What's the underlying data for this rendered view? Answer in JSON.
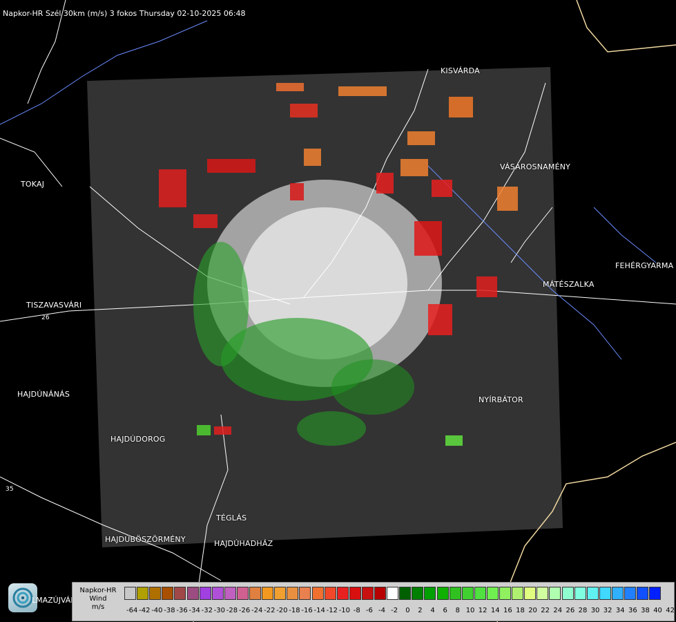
{
  "title": "Napkor-HR Szél 30km (m/s) 3 fokos Thursday 02-10-2025 06:48",
  "cities": [
    {
      "name": "KISVÁRDA"
    },
    {
      "name": "TOKAJ"
    },
    {
      "name": "VÁSÁROSNAMÉNY"
    },
    {
      "name": "FEHÉRGYARMA"
    },
    {
      "name": "MÁTÉSZALKA"
    },
    {
      "name": "TISZAVASVÁRI"
    },
    {
      "name": "HAJDÚNÁNÁS"
    },
    {
      "name": "NYÍRBÁTOR"
    },
    {
      "name": "HAJDÚDOROG"
    },
    {
      "name": "TÉGLÁS"
    },
    {
      "name": "HAJDÚBÖSZÖRMÉNY"
    },
    {
      "name": "HAJDÚHADHÁZ"
    }
  ],
  "roads": [
    "26",
    "35"
  ],
  "logo_text": "LMAZÚJVÁR",
  "legend": {
    "line1": "Napkor-HR",
    "line2": "Wind",
    "line3": "m/s",
    "ticks": [
      "-64",
      "-42",
      "-40",
      "-38",
      "-36",
      "-34",
      "-32",
      "-30",
      "-28",
      "-26",
      "-24",
      "-22",
      "-20",
      "-18",
      "-16",
      "-14",
      "-12",
      "-10",
      "-8",
      "-6",
      "-4",
      "-2",
      "0",
      "2",
      "4",
      "6",
      "8",
      "10",
      "12",
      "14",
      "16",
      "18",
      "20",
      "22",
      "24",
      "26",
      "28",
      "30",
      "32",
      "34",
      "36",
      "38",
      "40",
      "42"
    ],
    "colors": [
      "#c8c8c8",
      "#b0a000",
      "#b07000",
      "#a85000",
      "#a04848",
      "#9c4c80",
      "#a040e0",
      "#b050d8",
      "#c060c0",
      "#d06090",
      "#e08040",
      "#f09820",
      "#f0a030",
      "#e89040",
      "#e88050",
      "#f07030",
      "#f04828",
      "#e82020",
      "#d81010",
      "#c81010",
      "#b80000",
      "#ffffff",
      "#006000",
      "#008000",
      "#00a000",
      "#10b000",
      "#30c020",
      "#40d030",
      "#50e040",
      "#70f050",
      "#90f060",
      "#b0f070",
      "#e0ff80",
      "#d0ffa0",
      "#b0ffb0",
      "#90ffd0",
      "#80ffe0",
      "#60f0f0",
      "#40d8ff",
      "#30b0ff",
      "#2080ff",
      "#1050ff",
      "#0020ff"
    ]
  }
}
